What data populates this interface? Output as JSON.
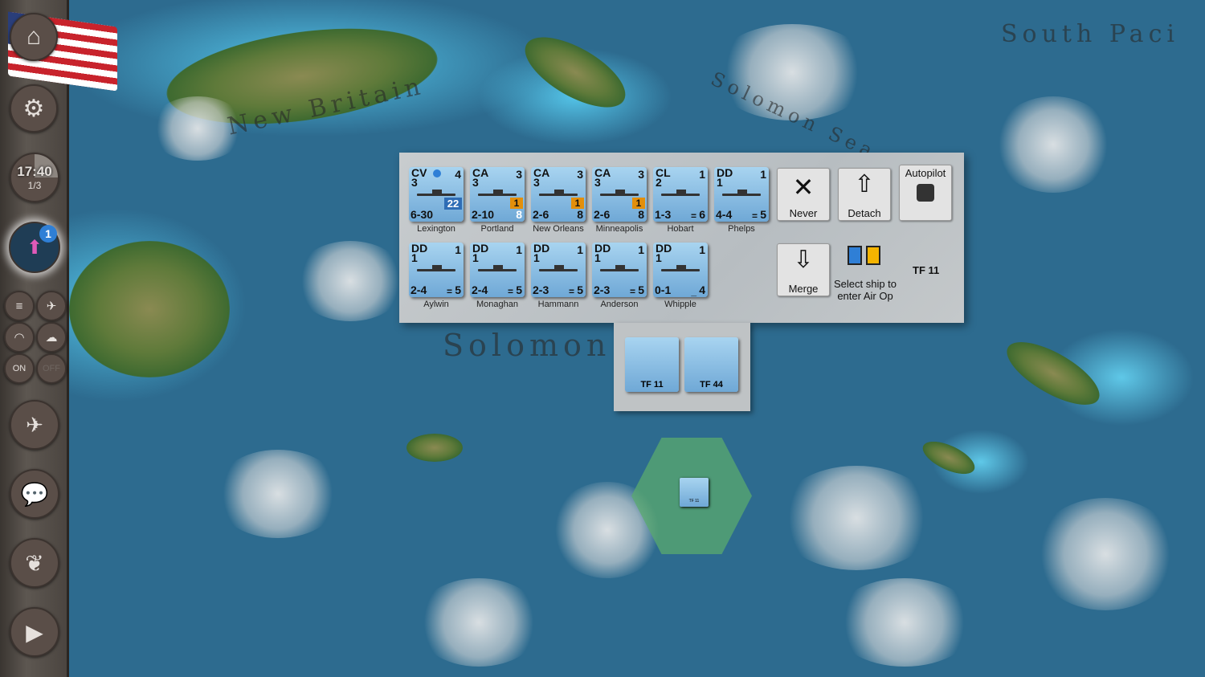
{
  "sidebar": {
    "home_icon": "home-icon",
    "settings_icon": "gear-icon",
    "clock": {
      "time": "17:40",
      "phase": "1/3",
      "progress": 0.25
    },
    "taskforce_badge": "1",
    "toggles": [
      {
        "icon": "ships-icon"
      },
      {
        "icon": "aircraft-icon"
      },
      {
        "icon": "signal-icon"
      },
      {
        "icon": "cloud-icon"
      },
      {
        "label": "ON"
      },
      {
        "label": "OFF"
      }
    ]
  },
  "map": {
    "labels": [
      "New Britain",
      "Solomon",
      "South Paci",
      "Solomon Sea"
    ]
  },
  "ship_panel": {
    "ships": [
      {
        "type": "CV",
        "tl2": "3",
        "tr": "4",
        "bl": "6-30",
        "br": "",
        "name": "Lexington",
        "badge": "22",
        "badge_color": "#2f6db5",
        "dot": true
      },
      {
        "type": "CA",
        "tl2": "3",
        "tr": "3",
        "bl": "2-10",
        "br": "8",
        "name": "Portland",
        "badge": "1",
        "badge_color": "#e38f0b"
      },
      {
        "type": "CA",
        "tl2": "3",
        "tr": "3",
        "bl": "2-6",
        "br": "8",
        "name": "New Orleans",
        "badge": "1",
        "badge_color": "#e38f0b"
      },
      {
        "type": "CA",
        "tl2": "3",
        "tr": "3",
        "bl": "2-6",
        "br": "8",
        "name": "Minneapolis",
        "badge": "1",
        "badge_color": "#e38f0b"
      },
      {
        "type": "CL",
        "tl2": "2",
        "tr": "1",
        "bl": "1-3",
        "br": "6",
        "eq": "=",
        "name": "Hobart"
      },
      {
        "type": "DD",
        "tl2": "1",
        "tr": "1",
        "bl": "4-4",
        "br": "5",
        "eq": "=",
        "name": "Phelps"
      },
      {
        "type": "DD",
        "tl2": "1",
        "tr": "1",
        "bl": "2-4",
        "br": "5",
        "eq": "=",
        "name": "Aylwin"
      },
      {
        "type": "DD",
        "tl2": "1",
        "tr": "1",
        "bl": "2-4",
        "br": "5",
        "eq": "=",
        "name": "Monaghan"
      },
      {
        "type": "DD",
        "tl2": "1",
        "tr": "1",
        "bl": "2-3",
        "br": "5",
        "eq": "=",
        "name": "Hammann"
      },
      {
        "type": "DD",
        "tl2": "1",
        "tr": "1",
        "bl": "2-3",
        "br": "5",
        "eq": "=",
        "name": "Anderson"
      },
      {
        "type": "DD",
        "tl2": "1",
        "tr": "1",
        "bl": "0-1",
        "br": "4",
        "eq": "_",
        "name": "Whipple"
      }
    ],
    "actions": {
      "never": "Never",
      "detach": "Detach",
      "autopilot": "Autopilot",
      "merge": "Merge"
    },
    "air_op_hint": "Select ship to enter Air Op",
    "air_op_colors": [
      "#2f7fd6",
      "#f5b400"
    ],
    "taskforce": "TF 11"
  },
  "taskforces": [
    "TF 11",
    "TF 44"
  ],
  "stack_label": "TF 11"
}
